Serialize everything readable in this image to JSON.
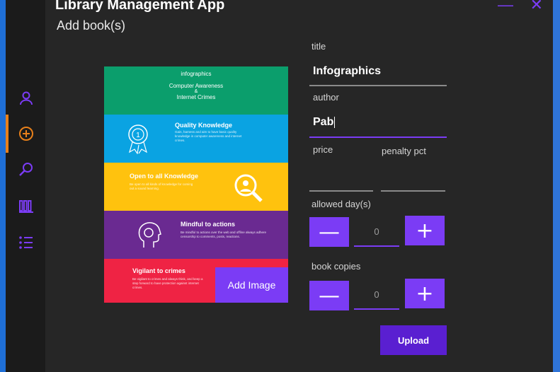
{
  "app": {
    "title": "Library Management App",
    "page_title": "Add book(s)"
  },
  "window_controls": {
    "minimize": "—",
    "close": "✕"
  },
  "sidebar": {
    "items": [
      {
        "icon": "user-icon"
      },
      {
        "icon": "add-circle-icon",
        "active": true
      },
      {
        "icon": "search-icon"
      },
      {
        "icon": "books-icon"
      },
      {
        "icon": "list-icon"
      }
    ]
  },
  "poster": {
    "b1": {
      "heading": "infographics",
      "line1": "Computer Awareness",
      "line2": "&",
      "line3": "Internet Crimes"
    },
    "b2": {
      "heading": "Quality Knowledge",
      "body": "Gain, harness and aim to have basic quality knowledge in computer awareness and internet crimes."
    },
    "b3": {
      "heading": "Open to all Knowledge",
      "body": "Be open to all kinds of knowledge for coming out a sound learning."
    },
    "b4": {
      "heading": "Mindful to actions",
      "body": "Be mindful to actions over the web and offline always adhere censorship to comments, posts, reactions."
    },
    "b5": {
      "heading": "Vigilant to crimes",
      "body": "Be vigilant to crimes and always think, and keep a step forward to have protection against internet crimes."
    }
  },
  "add_image_label": "Add Image",
  "form": {
    "title_label": "title",
    "title_value": "Infographics",
    "author_label": "author",
    "author_value": "Pab",
    "price_label": "price",
    "penalty_label": "penalty pct",
    "allowed_days_label": "allowed day(s)",
    "allowed_days_value": "0",
    "copies_label": "book copies",
    "copies_value": "0",
    "minus": "—",
    "plus": "+"
  },
  "upload_label": "Upload"
}
